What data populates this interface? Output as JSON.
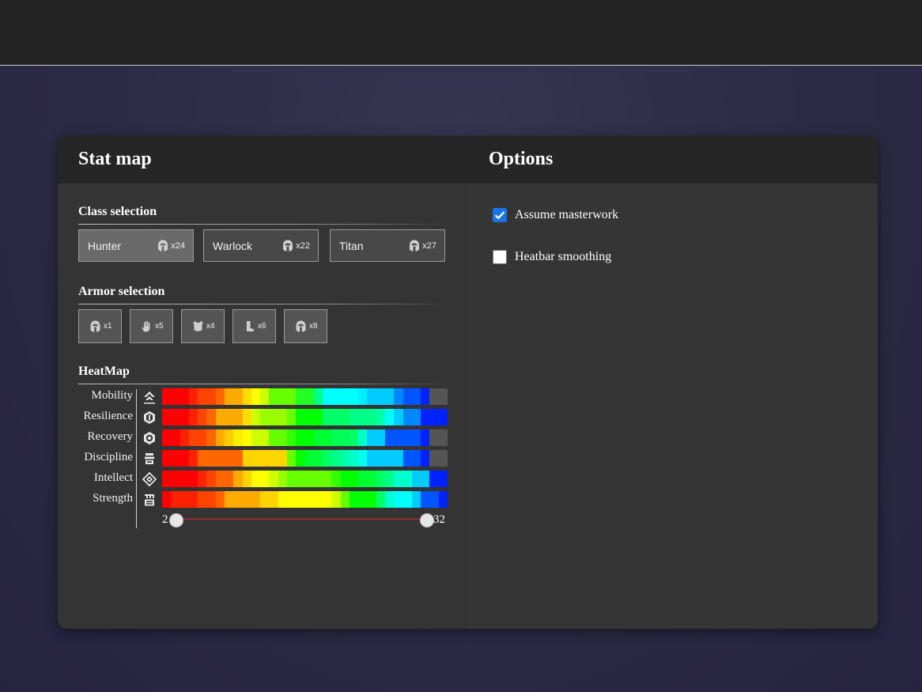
{
  "stat_map": {
    "title": "Stat map",
    "class_section": "Class selection",
    "classes": [
      {
        "name": "Hunter",
        "count": "x24",
        "active": true
      },
      {
        "name": "Warlock",
        "count": "x22",
        "active": false
      },
      {
        "name": "Titan",
        "count": "x27",
        "active": false
      }
    ],
    "armor_section": "Armor selection",
    "armor": [
      {
        "icon": "helmet-icon",
        "count": "x1"
      },
      {
        "icon": "gauntlets-icon",
        "count": "x5"
      },
      {
        "icon": "chest-armor-icon",
        "count": "x4"
      },
      {
        "icon": "leg-armor-icon",
        "count": "x6"
      },
      {
        "icon": "class-item-icon",
        "count": "x8"
      }
    ],
    "heatmap_section": "HeatMap",
    "stats": [
      {
        "label": "Mobility",
        "icon": "mobility-icon",
        "cells": [
          "#ff0000",
          "#ff0000",
          "#ff0000",
          "#ff2200",
          "#ff4400",
          "#ff4400",
          "#ff6600",
          "#ffaa00",
          "#ffaa00",
          "#ffdd00",
          "#ffff00",
          "#ccff00",
          "#66ff00",
          "#66ff00",
          "#66ff00",
          "#22ff22",
          "#22ff22",
          "#00ff88",
          "#00ffff",
          "#00ffff",
          "#00ffff",
          "#00ffff",
          "#00eeff",
          "#00ccff",
          "#00ccff",
          "#00ccff",
          "#0088ff",
          "#0055ff",
          "#0055ff",
          "#0022ff",
          "#555555",
          "#555555"
        ]
      },
      {
        "label": "Resilience",
        "icon": "resilience-icon",
        "cells": [
          "#ff0000",
          "#ff0000",
          "#ff0000",
          "#ff2200",
          "#ff4400",
          "#ff6600",
          "#ffaa00",
          "#ffaa00",
          "#ffaa00",
          "#ffdd00",
          "#ccff00",
          "#99ff00",
          "#99ff00",
          "#99ff00",
          "#66ff00",
          "#00ff00",
          "#00ff00",
          "#00ff00",
          "#00ff66",
          "#00ff66",
          "#00ff66",
          "#00ff88",
          "#00ff88",
          "#00ff88",
          "#00ffaa",
          "#00ffff",
          "#00ccff",
          "#0088ff",
          "#0088ff",
          "#0022ff",
          "#0022ff",
          "#0022ff"
        ]
      },
      {
        "label": "Recovery",
        "icon": "recovery-icon",
        "cells": [
          "#ff0000",
          "#ff0000",
          "#ff2200",
          "#ff4400",
          "#ff4400",
          "#ff6600",
          "#ffaa00",
          "#ffcc00",
          "#ffee00",
          "#ffff00",
          "#ccff00",
          "#ccff00",
          "#66ff00",
          "#66ff00",
          "#33ff00",
          "#00ff00",
          "#00ff00",
          "#00ff33",
          "#00ff33",
          "#00ff55",
          "#00ff55",
          "#00ff66",
          "#00ffcc",
          "#00ccff",
          "#00ccff",
          "#0055ff",
          "#0055ff",
          "#0055ff",
          "#0055ff",
          "#0022ff",
          "#555555",
          "#555555"
        ]
      },
      {
        "label": "Discipline",
        "icon": "discipline-icon",
        "cells": [
          "#ff0000",
          "#ff0000",
          "#ff0000",
          "#ff2200",
          "#ff6600",
          "#ff6600",
          "#ff6600",
          "#ff6600",
          "#ff6600",
          "#ffd400",
          "#ffd400",
          "#ffd400",
          "#ffd400",
          "#ffd400",
          "#66ff00",
          "#00ff00",
          "#00ff33",
          "#00ff33",
          "#00ff66",
          "#00ff88",
          "#00ffaa",
          "#00ffcc",
          "#00ffee",
          "#00ccff",
          "#00ccff",
          "#00ccff",
          "#00ccff",
          "#0055ff",
          "#0055ff",
          "#0022ff",
          "#555555",
          "#555555"
        ]
      },
      {
        "label": "Intellect",
        "icon": "intellect-icon",
        "cells": [
          "#ff0000",
          "#ff0000",
          "#ff0000",
          "#ff0000",
          "#ff2200",
          "#ff4400",
          "#ff6600",
          "#ff6600",
          "#ffaa00",
          "#ffd400",
          "#ffff00",
          "#ffff00",
          "#ccff00",
          "#99ff00",
          "#66ff00",
          "#66ff00",
          "#66ff00",
          "#66ff00",
          "#66ff00",
          "#33ff00",
          "#00ff00",
          "#00ff00",
          "#00ff33",
          "#00ff33",
          "#00ff66",
          "#00ff88",
          "#00ffcc",
          "#00ffcc",
          "#00ccff",
          "#00ccff",
          "#0022ff",
          "#0022ff"
        ]
      },
      {
        "label": "Strength",
        "icon": "strength-icon",
        "cells": [
          "#ff0000",
          "#ff2200",
          "#ff2200",
          "#ff2200",
          "#ff4400",
          "#ff4400",
          "#ff6600",
          "#ffaa00",
          "#ffaa00",
          "#ffaa00",
          "#ffaa00",
          "#ffd400",
          "#ffd400",
          "#ffff00",
          "#ffff00",
          "#ffff00",
          "#ffff00",
          "#ffff00",
          "#ffff00",
          "#ccff00",
          "#66ff00",
          "#00ff00",
          "#00ff00",
          "#00ff00",
          "#00ff66",
          "#00ffcc",
          "#00ffff",
          "#00ffff",
          "#00ccff",
          "#0055ff",
          "#0055ff",
          "#0022ff"
        ]
      }
    ],
    "slider": {
      "min_label": "2",
      "max_label": "32",
      "low_value": 2,
      "high_value": 32,
      "range_min": 2,
      "range_max": 32
    }
  },
  "options": {
    "title": "Options",
    "items": [
      {
        "label": "Assume masterwork",
        "checked": true
      },
      {
        "label": "Heatbar smoothing",
        "checked": false
      }
    ]
  },
  "colors": {
    "checkbox_accent": "#1a73e8",
    "slider_track": "#dd2222"
  }
}
